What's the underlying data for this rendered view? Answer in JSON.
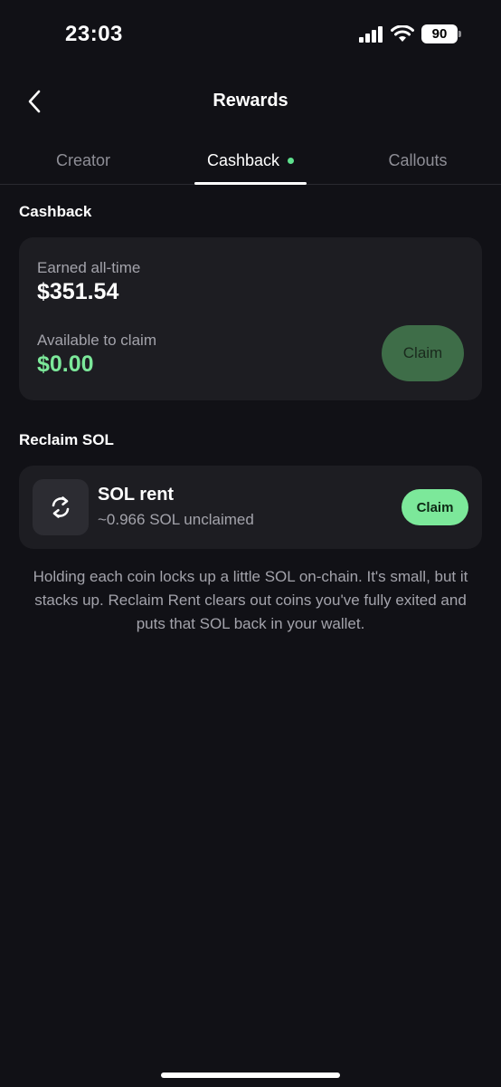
{
  "status_bar": {
    "time": "23:03",
    "battery": "90",
    "icons": [
      "signal-icon",
      "wifi-icon",
      "battery-icon"
    ]
  },
  "header": {
    "title": "Rewards",
    "back_icon": "chevron-left-icon"
  },
  "tabs": [
    {
      "label": "Creator",
      "active": false
    },
    {
      "label": "Cashback",
      "active": true,
      "indicator_color": "#5ee08d"
    },
    {
      "label": "Callouts",
      "active": false
    }
  ],
  "cashback": {
    "section_title": "Cashback",
    "earned_label": "Earned all-time",
    "earned_value": "$351.54",
    "available_label": "Available to claim",
    "available_value": "$0.00",
    "available_color": "#7ce89a",
    "claim_label": "Claim"
  },
  "reclaim": {
    "section_title": "Reclaim SOL",
    "item_title": "SOL rent",
    "item_subtitle": "~0.966 SOL unclaimed",
    "item_icon": "refresh-icon",
    "claim_label": "Claim",
    "info": "Holding each coin locks up a little SOL on-chain. It's small, but it stacks up. Reclaim Rent clears out coins you've fully exited and puts that SOL back in your wallet."
  },
  "colors": {
    "background": "#111116",
    "card": "#1d1d22",
    "accent_green": "#7ce89a"
  }
}
